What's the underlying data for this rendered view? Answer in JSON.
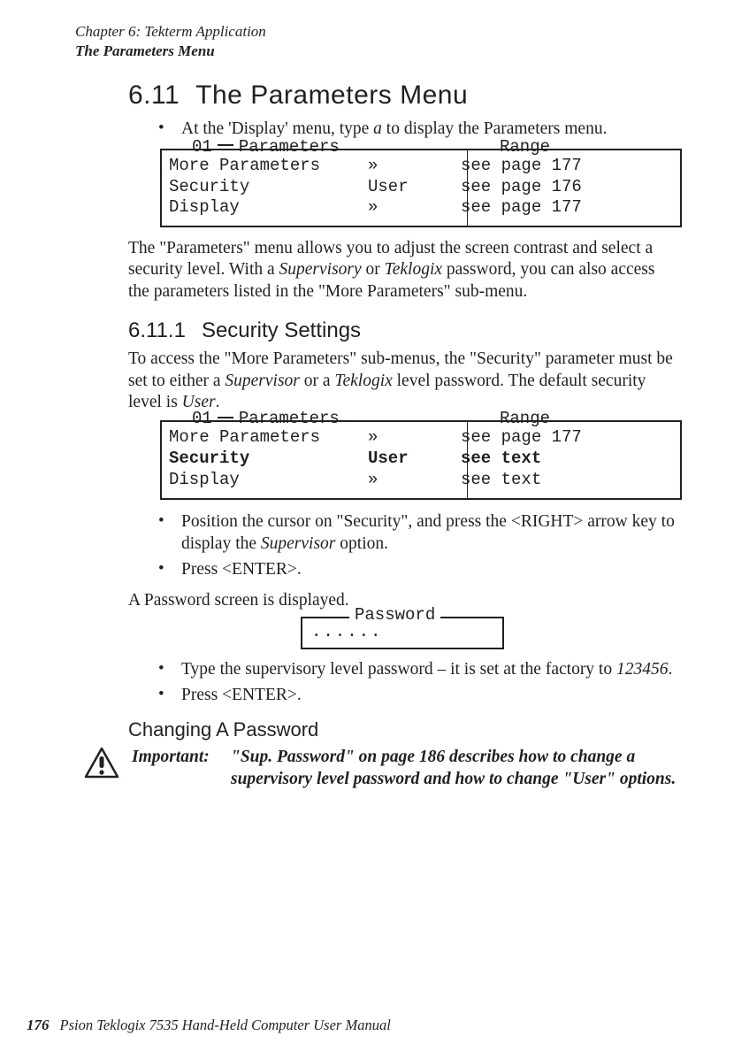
{
  "header": {
    "line1": "Chapter 6: Tekterm Application",
    "line2": "The Parameters Menu"
  },
  "section": {
    "number": "6.11",
    "title": "The Parameters Menu",
    "bullet1_pre": "At the 'Display' menu, type ",
    "bullet1_mid": "a",
    "bullet1_post": " to display the Parameters menu."
  },
  "menu1": {
    "legend_a": "01",
    "legend_b": "Parameters",
    "legend_right": "Range",
    "rows": [
      {
        "name": "More Parameters",
        "value": "»",
        "range": "see page 177"
      },
      {
        "name": "Security",
        "value": "User",
        "range": "see page 176"
      },
      {
        "name": "Display",
        "value": "»",
        "range": "see page 177"
      }
    ]
  },
  "para1_a": "The \"Parameters\" menu allows you to adjust the screen contrast and select a security level. With a ",
  "para1_b": "Supervisory",
  "para1_c": " or ",
  "para1_d": "Teklogix",
  "para1_e": " password, you can also access the parameters listed in the \"More Parameters\" sub-menu.",
  "subsection": {
    "number": "6.11.1",
    "title": "Security Settings",
    "para_a": "To access the \"More Parameters\" sub-menus, the \"Security\" parameter must be set to either a ",
    "para_b": "Supervisor",
    "para_c": " or a ",
    "para_d": "Teklogix",
    "para_e": " level password. The default security level is ",
    "para_f": "User",
    "para_g": "."
  },
  "menu2": {
    "legend_a": "01",
    "legend_b": "Parameters",
    "legend_right": "Range",
    "rows": [
      {
        "name": "More Parameters",
        "value": "»",
        "range": "see page 177",
        "bold": false
      },
      {
        "name": "Security",
        "value": "User",
        "range": "see text",
        "bold": true
      },
      {
        "name": "Display",
        "value": "»",
        "range": "see text",
        "bold": false
      }
    ]
  },
  "bullets2": {
    "b1_a": "Position the cursor on \"Security\", and press the <RIGHT> arrow key to display the ",
    "b1_b": "Supervisor",
    "b1_c": " option.",
    "b2": "Press <ENTER>."
  },
  "para_pw": "A Password screen is displayed.",
  "password_box": {
    "legend": "Password",
    "content": "......"
  },
  "bullets3": {
    "b1_a": "Type the supervisory level password – it is set at the factory to ",
    "b1_b": "123456",
    "b1_c": ".",
    "b2": "Press <ENTER>."
  },
  "change_heading": "Changing A Password",
  "callout": {
    "label": "Important:",
    "msg": "\"Sup. Password\" on page 186 describes how to change a supervisory level password and how to change \"User\" options."
  },
  "footer": {
    "pageno": "176",
    "text": "Psion Teklogix 7535 Hand-Held Computer User Manual"
  }
}
